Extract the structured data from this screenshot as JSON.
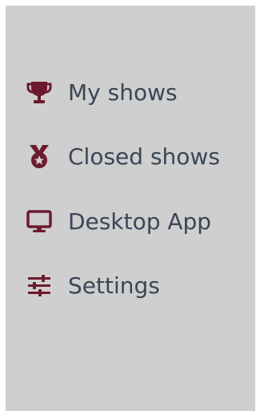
{
  "theme": {
    "background": "#ffffff",
    "panel_background": "#cfcfcf",
    "icon_color": "#6d1a2f",
    "text_color": "#3a4656"
  },
  "menu": {
    "items": [
      {
        "label": "My shows",
        "icon": "trophy-icon"
      },
      {
        "label": "Closed shows",
        "icon": "medal-icon"
      },
      {
        "label": "Desktop App",
        "icon": "monitor-icon"
      },
      {
        "label": "Settings",
        "icon": "sliders-icon"
      }
    ]
  }
}
